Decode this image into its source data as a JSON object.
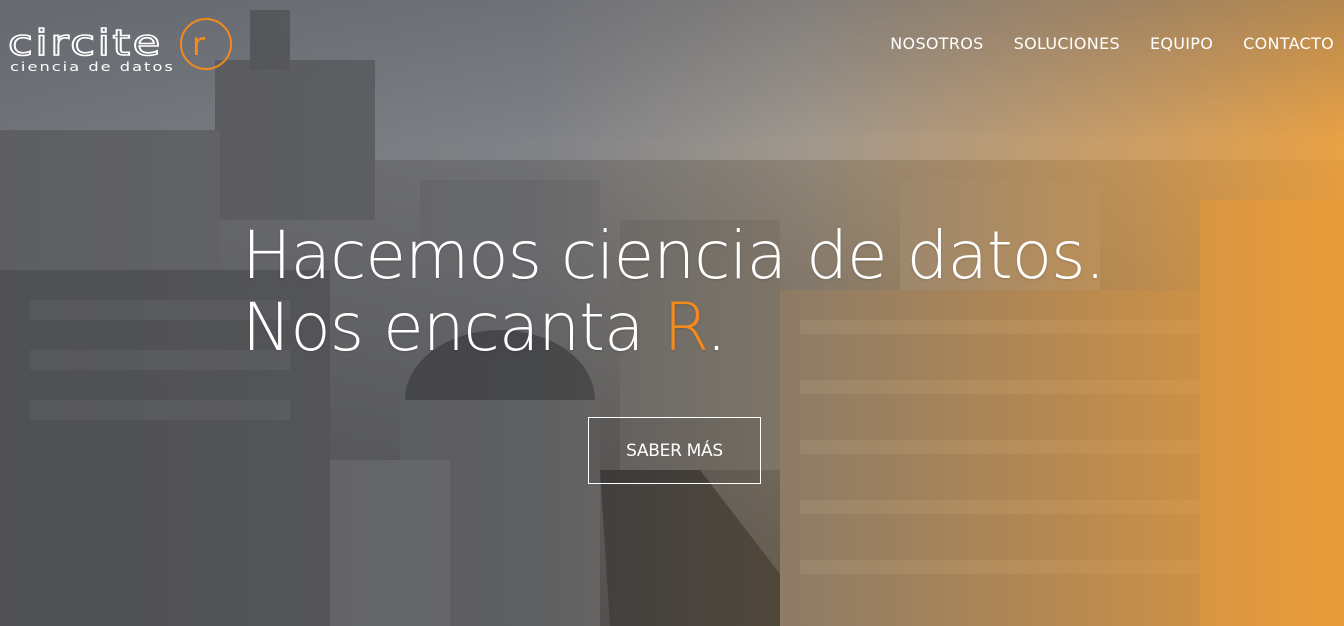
{
  "logo": {
    "word": "circite",
    "letter": "r",
    "tagline": "ciencia de datos"
  },
  "nav": {
    "items": [
      {
        "label": "NOSOTROS"
      },
      {
        "label": "SOLUCIONES"
      },
      {
        "label": "EQUIPO"
      },
      {
        "label": "CONTACTO"
      }
    ]
  },
  "hero": {
    "line1": "Hacemos ciencia de datos.",
    "line2_prefix": "Nos encanta ",
    "line2_accent": "R",
    "line2_suffix": ".",
    "cta_label": "SABER MÁS",
    "background_image": "city-skyline-photo"
  },
  "colors": {
    "accent": "#f28a1e",
    "text": "#ffffff"
  }
}
